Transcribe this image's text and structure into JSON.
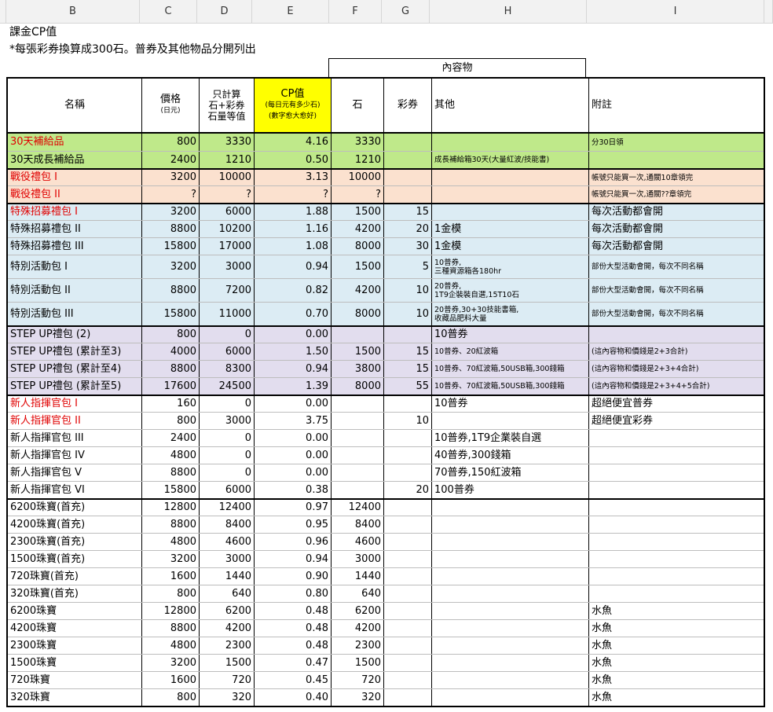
{
  "columns": [
    "B",
    "C",
    "D",
    "E",
    "F",
    "G",
    "H",
    "I"
  ],
  "notes": [
    "課金CP值",
    "*每張彩券換算成300石。普券及其他物品分開列出"
  ],
  "table": {
    "group_header": "內容物",
    "headers": {
      "name": "名稱",
      "price": "價格",
      "price_sub": "(日元)",
      "stone_total_1": "只計算",
      "stone_total_2": "石+彩券",
      "stone_total_3": "石量等值",
      "cp": "CP值",
      "cp_sub_1": "(每日元有多少石)",
      "cp_sub_2": "(數字愈大愈好)",
      "stone": "石",
      "ticket": "彩券",
      "other": "其他",
      "note": "附註"
    },
    "colors": {
      "green": "#bfe98a",
      "peach": "#fbe1cf",
      "blue": "#dcecf4",
      "purple": "#e2ddee",
      "white": "#ffffff",
      "cp_header": "#ffff00",
      "red_text": "#e00000"
    },
    "rows": [
      {
        "name": "30天補給品",
        "red": true,
        "c": "800",
        "d": "3330",
        "e": "4.16",
        "f": "3330",
        "g": "",
        "h": "",
        "i": "分30日領",
        "fill": "green",
        "h_small": false,
        "i_small": true,
        "height": 22
      },
      {
        "name": "30天成長補給品",
        "red": false,
        "c": "2400",
        "d": "1210",
        "e": "0.50",
        "f": "1210",
        "g": "",
        "h": "成長補給箱30天(大量紅波/技能書)",
        "i": "",
        "fill": "green",
        "h_small": true,
        "i_small": false,
        "height": 22
      },
      {
        "name": "戰役禮包 I",
        "red": true,
        "c": "3200",
        "d": "10000",
        "e": "3.13",
        "f": "10000",
        "g": "",
        "h": "",
        "i": "帳號只能買一次,通關10章領完",
        "fill": "peach",
        "h_small": false,
        "i_small": true,
        "height": 22
      },
      {
        "name": "戰役禮包 II",
        "red": true,
        "c": "?",
        "d": "?",
        "e": "?",
        "f": "?",
        "g": "",
        "h": "",
        "i": "帳號只能買一次,通關??章領完",
        "fill": "peach",
        "h_small": false,
        "i_small": true,
        "height": 22
      },
      {
        "name": "特殊招募禮包 I",
        "red": true,
        "c": "3200",
        "d": "6000",
        "e": "1.88",
        "f": "1500",
        "g": "15",
        "h": "",
        "i": "每次活動都會開",
        "fill": "blue",
        "h_small": false,
        "i_small": false,
        "height": 22
      },
      {
        "name": "特殊招募禮包 II",
        "red": false,
        "c": "8800",
        "d": "10200",
        "e": "1.16",
        "f": "4200",
        "g": "20",
        "h": "1金模",
        "i": "每次活動都會開",
        "fill": "blue",
        "h_small": false,
        "i_small": false,
        "height": 22
      },
      {
        "name": "特殊招募禮包 III",
        "red": false,
        "c": "15800",
        "d": "17000",
        "e": "1.08",
        "f": "8000",
        "g": "30",
        "h": "1金模",
        "i": "每次活動都會開",
        "fill": "blue",
        "h_small": false,
        "i_small": false,
        "height": 22
      },
      {
        "name": "特別活動包 I",
        "red": false,
        "c": "3200",
        "d": "3000",
        "e": "0.94",
        "f": "1500",
        "g": "5",
        "h": "10普券,\n三種資源箱各180hr",
        "i": "部份大型活動會開，每次不同名稱",
        "fill": "blue",
        "h_small": true,
        "i_small": true,
        "height": 30
      },
      {
        "name": "特別活動包 II",
        "red": false,
        "c": "8800",
        "d": "7200",
        "e": "0.82",
        "f": "4200",
        "g": "10",
        "h": "20普券,\n1T9企裝裝自選,15T10石",
        "i": "部份大型活動會開，每次不同名稱",
        "fill": "blue",
        "h_small": true,
        "i_small": true,
        "height": 30
      },
      {
        "name": "特別活動包 III",
        "red": false,
        "c": "15800",
        "d": "11000",
        "e": "0.70",
        "f": "8000",
        "g": "10",
        "h": "20普券,30+30技能書箱,\n收藏品肥料大量",
        "i": "部份大型活動會開，每次不同名稱",
        "fill": "blue",
        "h_small": true,
        "i_small": true,
        "height": 30
      },
      {
        "name": "STEP UP禮包 (2)",
        "red": false,
        "c": "800",
        "d": "0",
        "e": "0.00",
        "f": "",
        "g": "",
        "h": "10普券",
        "i": "",
        "fill": "purple",
        "h_small": false,
        "i_small": false,
        "height": 22
      },
      {
        "name": "STEP UP禮包 (累計至3)",
        "red": false,
        "c": "4000",
        "d": "6000",
        "e": "1.50",
        "f": "1500",
        "g": "15",
        "h": "10普券、20紅波箱",
        "i": "(這內容物和價錢是2+3合計)",
        "fill": "purple",
        "h_small": true,
        "i_small": true,
        "height": 22
      },
      {
        "name": "STEP UP禮包 (累計至4)",
        "red": false,
        "c": "8800",
        "d": "8300",
        "e": "0.94",
        "f": "3800",
        "g": "15",
        "h": "10普券、70紅波箱,50USB箱,300錢箱",
        "i": "(這內容物和價錢是2+3+4合計)",
        "fill": "purple",
        "h_small": true,
        "i_small": true,
        "height": 22
      },
      {
        "name": "STEP UP禮包 (累計至5)",
        "red": false,
        "c": "17600",
        "d": "24500",
        "e": "1.39",
        "f": "8000",
        "g": "55",
        "h": "10普券、70紅波箱,50USB箱,300錢箱",
        "i": "(這內容物和價錢是2+3+4+5合計)",
        "fill": "purple",
        "h_small": true,
        "i_small": true,
        "height": 22
      },
      {
        "name": "新人指揮官包 I",
        "red": true,
        "c": "160",
        "d": "0",
        "e": "0.00",
        "f": "",
        "g": "",
        "h": "10普券",
        "i": "超絕便宜普券",
        "fill": "white",
        "h_small": false,
        "i_small": false,
        "height": 22
      },
      {
        "name": "新人指揮官包 II",
        "red": true,
        "c": "800",
        "d": "3000",
        "e": "3.75",
        "f": "",
        "g": "10",
        "h": "",
        "i": "超絕便宜彩券",
        "fill": "white",
        "h_small": false,
        "i_small": false,
        "height": 22
      },
      {
        "name": "新人指揮官包 III",
        "red": false,
        "c": "2400",
        "d": "0",
        "e": "0.00",
        "f": "",
        "g": "",
        "h": "10普券,1T9企業裝自選",
        "i": "",
        "fill": "white",
        "h_small": false,
        "i_small": false,
        "height": 22
      },
      {
        "name": "新人指揮官包 IV",
        "red": false,
        "c": "4800",
        "d": "0",
        "e": "0.00",
        "f": "",
        "g": "",
        "h": "40普券,300錢箱",
        "i": "",
        "fill": "white",
        "h_small": false,
        "i_small": false,
        "height": 22
      },
      {
        "name": "新人指揮官包 V",
        "red": false,
        "c": "8800",
        "d": "0",
        "e": "0.00",
        "f": "",
        "g": "",
        "h": "70普券,150紅波箱",
        "i": "",
        "fill": "white",
        "h_small": false,
        "i_small": false,
        "height": 22
      },
      {
        "name": "新人指揮官包 VI",
        "red": false,
        "c": "15800",
        "d": "6000",
        "e": "0.38",
        "f": "",
        "g": "20",
        "h": "100普券",
        "i": "",
        "fill": "white",
        "h_small": false,
        "i_small": false,
        "height": 22
      },
      {
        "name": "6200珠寶(首充)",
        "red": false,
        "c": "12800",
        "d": "12400",
        "e": "0.97",
        "f": "12400",
        "g": "",
        "h": "",
        "i": "",
        "fill": "white",
        "h_small": false,
        "i_small": false,
        "height": 22
      },
      {
        "name": "4200珠寶(首充)",
        "red": false,
        "c": "8800",
        "d": "8400",
        "e": "0.95",
        "f": "8400",
        "g": "",
        "h": "",
        "i": "",
        "fill": "white",
        "h_small": false,
        "i_small": false,
        "height": 22
      },
      {
        "name": "2300珠寶(首充)",
        "red": false,
        "c": "4800",
        "d": "4600",
        "e": "0.96",
        "f": "4600",
        "g": "",
        "h": "",
        "i": "",
        "fill": "white",
        "h_small": false,
        "i_small": false,
        "height": 22
      },
      {
        "name": "1500珠寶(首充)",
        "red": false,
        "c": "3200",
        "d": "3000",
        "e": "0.94",
        "f": "3000",
        "g": "",
        "h": "",
        "i": "",
        "fill": "white",
        "h_small": false,
        "i_small": false,
        "height": 22
      },
      {
        "name": "720珠寶(首充)",
        "red": false,
        "c": "1600",
        "d": "1440",
        "e": "0.90",
        "f": "1440",
        "g": "",
        "h": "",
        "i": "",
        "fill": "white",
        "h_small": false,
        "i_small": false,
        "height": 22
      },
      {
        "name": "320珠寶(首充)",
        "red": false,
        "c": "800",
        "d": "640",
        "e": "0.80",
        "f": "640",
        "g": "",
        "h": "",
        "i": "",
        "fill": "white",
        "h_small": false,
        "i_small": false,
        "height": 22
      },
      {
        "name": "6200珠寶",
        "red": false,
        "c": "12800",
        "d": "6200",
        "e": "0.48",
        "f": "6200",
        "g": "",
        "h": "",
        "i": "水魚",
        "fill": "white",
        "h_small": false,
        "i_small": false,
        "height": 22
      },
      {
        "name": "4200珠寶",
        "red": false,
        "c": "8800",
        "d": "4200",
        "e": "0.48",
        "f": "4200",
        "g": "",
        "h": "",
        "i": "水魚",
        "fill": "white",
        "h_small": false,
        "i_small": false,
        "height": 22
      },
      {
        "name": "2300珠寶",
        "red": false,
        "c": "4800",
        "d": "2300",
        "e": "0.48",
        "f": "2300",
        "g": "",
        "h": "",
        "i": "水魚",
        "fill": "white",
        "h_small": false,
        "i_small": false,
        "height": 22
      },
      {
        "name": "1500珠寶",
        "red": false,
        "c": "3200",
        "d": "1500",
        "e": "0.47",
        "f": "1500",
        "g": "",
        "h": "",
        "i": "水魚",
        "fill": "white",
        "h_small": false,
        "i_small": false,
        "height": 22
      },
      {
        "name": "720珠寶",
        "red": false,
        "c": "1600",
        "d": "720",
        "e": "0.45",
        "f": "720",
        "g": "",
        "h": "",
        "i": "水魚",
        "fill": "white",
        "h_small": false,
        "i_small": false,
        "height": 22
      },
      {
        "name": "320珠寶",
        "red": false,
        "c": "800",
        "d": "320",
        "e": "0.40",
        "f": "320",
        "g": "",
        "h": "",
        "i": "水魚",
        "fill": "white",
        "h_small": false,
        "i_small": false,
        "height": 22
      }
    ]
  }
}
